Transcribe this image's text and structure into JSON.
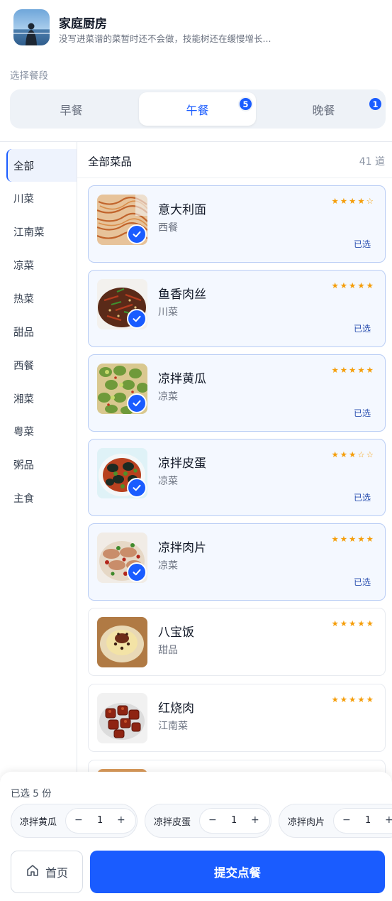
{
  "header": {
    "title": "家庭厨房",
    "subtitle": "没写进菜谱的菜暂时还不会做，技能树还在缓慢增长..."
  },
  "meal": {
    "label": "选择餐段",
    "tabs": [
      {
        "label": "早餐",
        "badge": null,
        "active": false
      },
      {
        "label": "午餐",
        "badge": "5",
        "active": true
      },
      {
        "label": "晚餐",
        "badge": "1",
        "active": false
      }
    ]
  },
  "categories": [
    "全部",
    "川菜",
    "江南菜",
    "凉菜",
    "热菜",
    "甜品",
    "西餐",
    "湘菜",
    "粤菜",
    "粥品",
    "主食"
  ],
  "list": {
    "title": "全部菜品",
    "count": "41 道"
  },
  "dishes": [
    {
      "name": "意大利面",
      "category": "西餐",
      "rating": 4,
      "stars": "★★★★☆",
      "selected": true,
      "selected_label": "已选"
    },
    {
      "name": "鱼香肉丝",
      "category": "川菜",
      "rating": 5,
      "stars": "★★★★★",
      "selected": true,
      "selected_label": "已选"
    },
    {
      "name": "凉拌黄瓜",
      "category": "凉菜",
      "rating": 5,
      "stars": "★★★★★",
      "selected": true,
      "selected_label": "已选"
    },
    {
      "name": "凉拌皮蛋",
      "category": "凉菜",
      "rating": 3,
      "stars": "★★★☆☆",
      "selected": true,
      "selected_label": "已选"
    },
    {
      "name": "凉拌肉片",
      "category": "凉菜",
      "rating": 5,
      "stars": "★★★★★",
      "selected": true,
      "selected_label": "已选"
    },
    {
      "name": "八宝饭",
      "category": "甜品",
      "rating": 5,
      "stars": "★★★★★",
      "selected": false,
      "selected_label": ""
    },
    {
      "name": "红烧肉",
      "category": "江南菜",
      "rating": 5,
      "stars": "★★★★★",
      "selected": false,
      "selected_label": ""
    }
  ],
  "cart": {
    "count_label": "已选 5 份",
    "items": [
      {
        "name": "凉拌黄瓜",
        "qty": "1"
      },
      {
        "name": "凉拌皮蛋",
        "qty": "1"
      },
      {
        "name": "凉拌肉片",
        "qty": "1"
      }
    ],
    "minus": "−",
    "plus": "+"
  },
  "footer": {
    "home_label": "首页",
    "submit_label": "提交点餐"
  },
  "colors": {
    "accent": "#1a5cff",
    "star": "#f59e0b",
    "selected_bg": "#f4f8ff"
  }
}
